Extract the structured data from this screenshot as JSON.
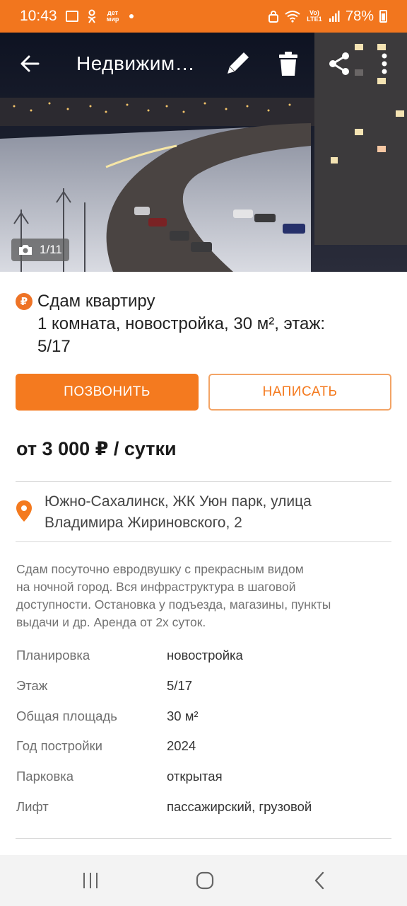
{
  "status_bar": {
    "time": "10:43",
    "notif_small_text": "дет мир",
    "network_text": "Vo) LTE1",
    "battery": "78%"
  },
  "top_nav": {
    "title": "Недвижим…",
    "back_icon": "arrow-left-icon",
    "edit_icon": "pencil-icon",
    "delete_icon": "trash-icon",
    "share_icon": "share-icon",
    "more_icon": "more-vertical-icon"
  },
  "gallery": {
    "counter": "1/11",
    "counter_icon": "camera-icon"
  },
  "listing": {
    "currency_badge": "₽",
    "title_line1": "Сдам квартиру",
    "title_line2": "1 комната, новостройка, 30 м², этаж:",
    "title_line3": "5/17"
  },
  "actions": {
    "call": "ПОЗВОНИТЬ",
    "write": "НАПИСАТЬ"
  },
  "price": "от 3 000 ₽ / сутки",
  "address": {
    "line1": "Южно-Сахалинск, ЖК Уюн парк, улица",
    "line2": "Владимира Жириновского, 2"
  },
  "description": {
    "line1": "Сдам посуточно евродвушку с прекрасным видом",
    "line2": "на ночной город. Вся инфраструктура в шаговой",
    "line3": "доступности. Остановка у подъезда, магазины, пункты",
    "line4": "выдачи и др. Аренда от 2х суток."
  },
  "params": [
    {
      "name": "Планировка",
      "value": "новостройка"
    },
    {
      "name": "Этаж",
      "value": "5/17"
    },
    {
      "name": "Общая площадь",
      "value": "30 м²"
    },
    {
      "name": "Год постройки",
      "value": "2024"
    },
    {
      "name": "Парковка",
      "value": "открытая"
    },
    {
      "name": "Лифт",
      "value": "пассажирский, грузовой"
    }
  ],
  "colors": {
    "accent": "#f47a1f",
    "status_bar": "#f2761e"
  }
}
